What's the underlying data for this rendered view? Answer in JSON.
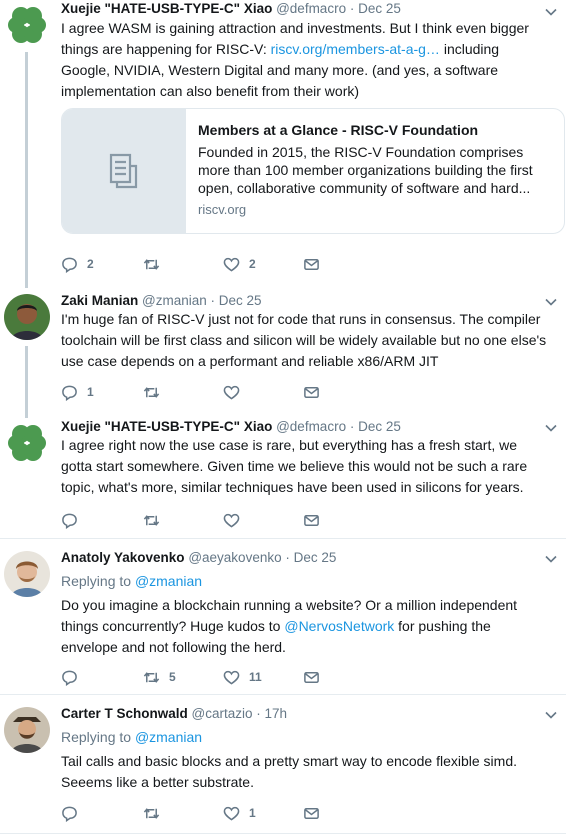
{
  "tweets": [
    {
      "name": "Xuejie \"HATE-USB-TYPE-C\" Xiao",
      "handle": "@defmacro",
      "time": "Dec 25",
      "text_a": "I agree WASM is gaining attraction and investments. But I think even bigger things are happening for RISC-V: ",
      "link": "riscv.org/members-at-a-g…",
      "text_b": " including Google, NVIDIA, Western Digital and many more. (and yes, a software implementation can also benefit from their work)",
      "card": {
        "title": "Members at a Glance - RISC-V Foundation",
        "desc": "Founded in 2015, the RISC-V Foundation comprises more than 100 member organizations building the first open, collaborative community of software and hard...",
        "domain": "riscv.org",
        "icon": "document-icon"
      },
      "replies": "2",
      "retweets": "",
      "likes": "2"
    },
    {
      "name": "Zaki Manian",
      "handle": "@zmanian",
      "time": "Dec 25",
      "text": "I'm huge fan of RISC-V just not for code that runs in consensus. The compiler toolchain will be first class and silicon will be widely available but no one else's use case depends on a performant and reliable x86/ARM JIT",
      "replies": "1",
      "retweets": "",
      "likes": ""
    },
    {
      "name": "Xuejie \"HATE-USB-TYPE-C\" Xiao",
      "handle": "@defmacro",
      "time": "Dec 25",
      "text": "I agree right now the use case is rare, but everything has a fresh start, we gotta start somewhere. Given time we believe this would not be such a rare topic, what's more, similar techniques have been used in silicons for years.",
      "replies": "",
      "retweets": "",
      "likes": ""
    },
    {
      "name": "Anatoly Yakovenko",
      "handle": "@aeyakovenko",
      "time": "Dec 25",
      "replying_prefix": "Replying to ",
      "replying_to": "@zmanian",
      "text_a": "Do you imagine a blockchain running a website? Or a million independent things concurrently?  Huge kudos to ",
      "mention": "@NervosNetwork",
      "text_b": " for pushing the envelope and not following the herd.",
      "replies": "",
      "retweets": "5",
      "likes": "11"
    },
    {
      "name": "Carter T Schonwald",
      "handle": "@cartazio",
      "time": "17h",
      "replying_prefix": "Replying to ",
      "replying_to": "@zmanian",
      "text": "Tail calls and basic blocks and a pretty smart way to encode flexible simd. Seeems like a better substrate.",
      "replies": "",
      "retweets": "",
      "likes": "1"
    }
  ],
  "separator": " · ",
  "colors": {
    "text": "#14171a",
    "muted": "#657786",
    "link": "#1b95e0",
    "thread_line": "#c4cfd6",
    "clover": "#4c9a50"
  }
}
